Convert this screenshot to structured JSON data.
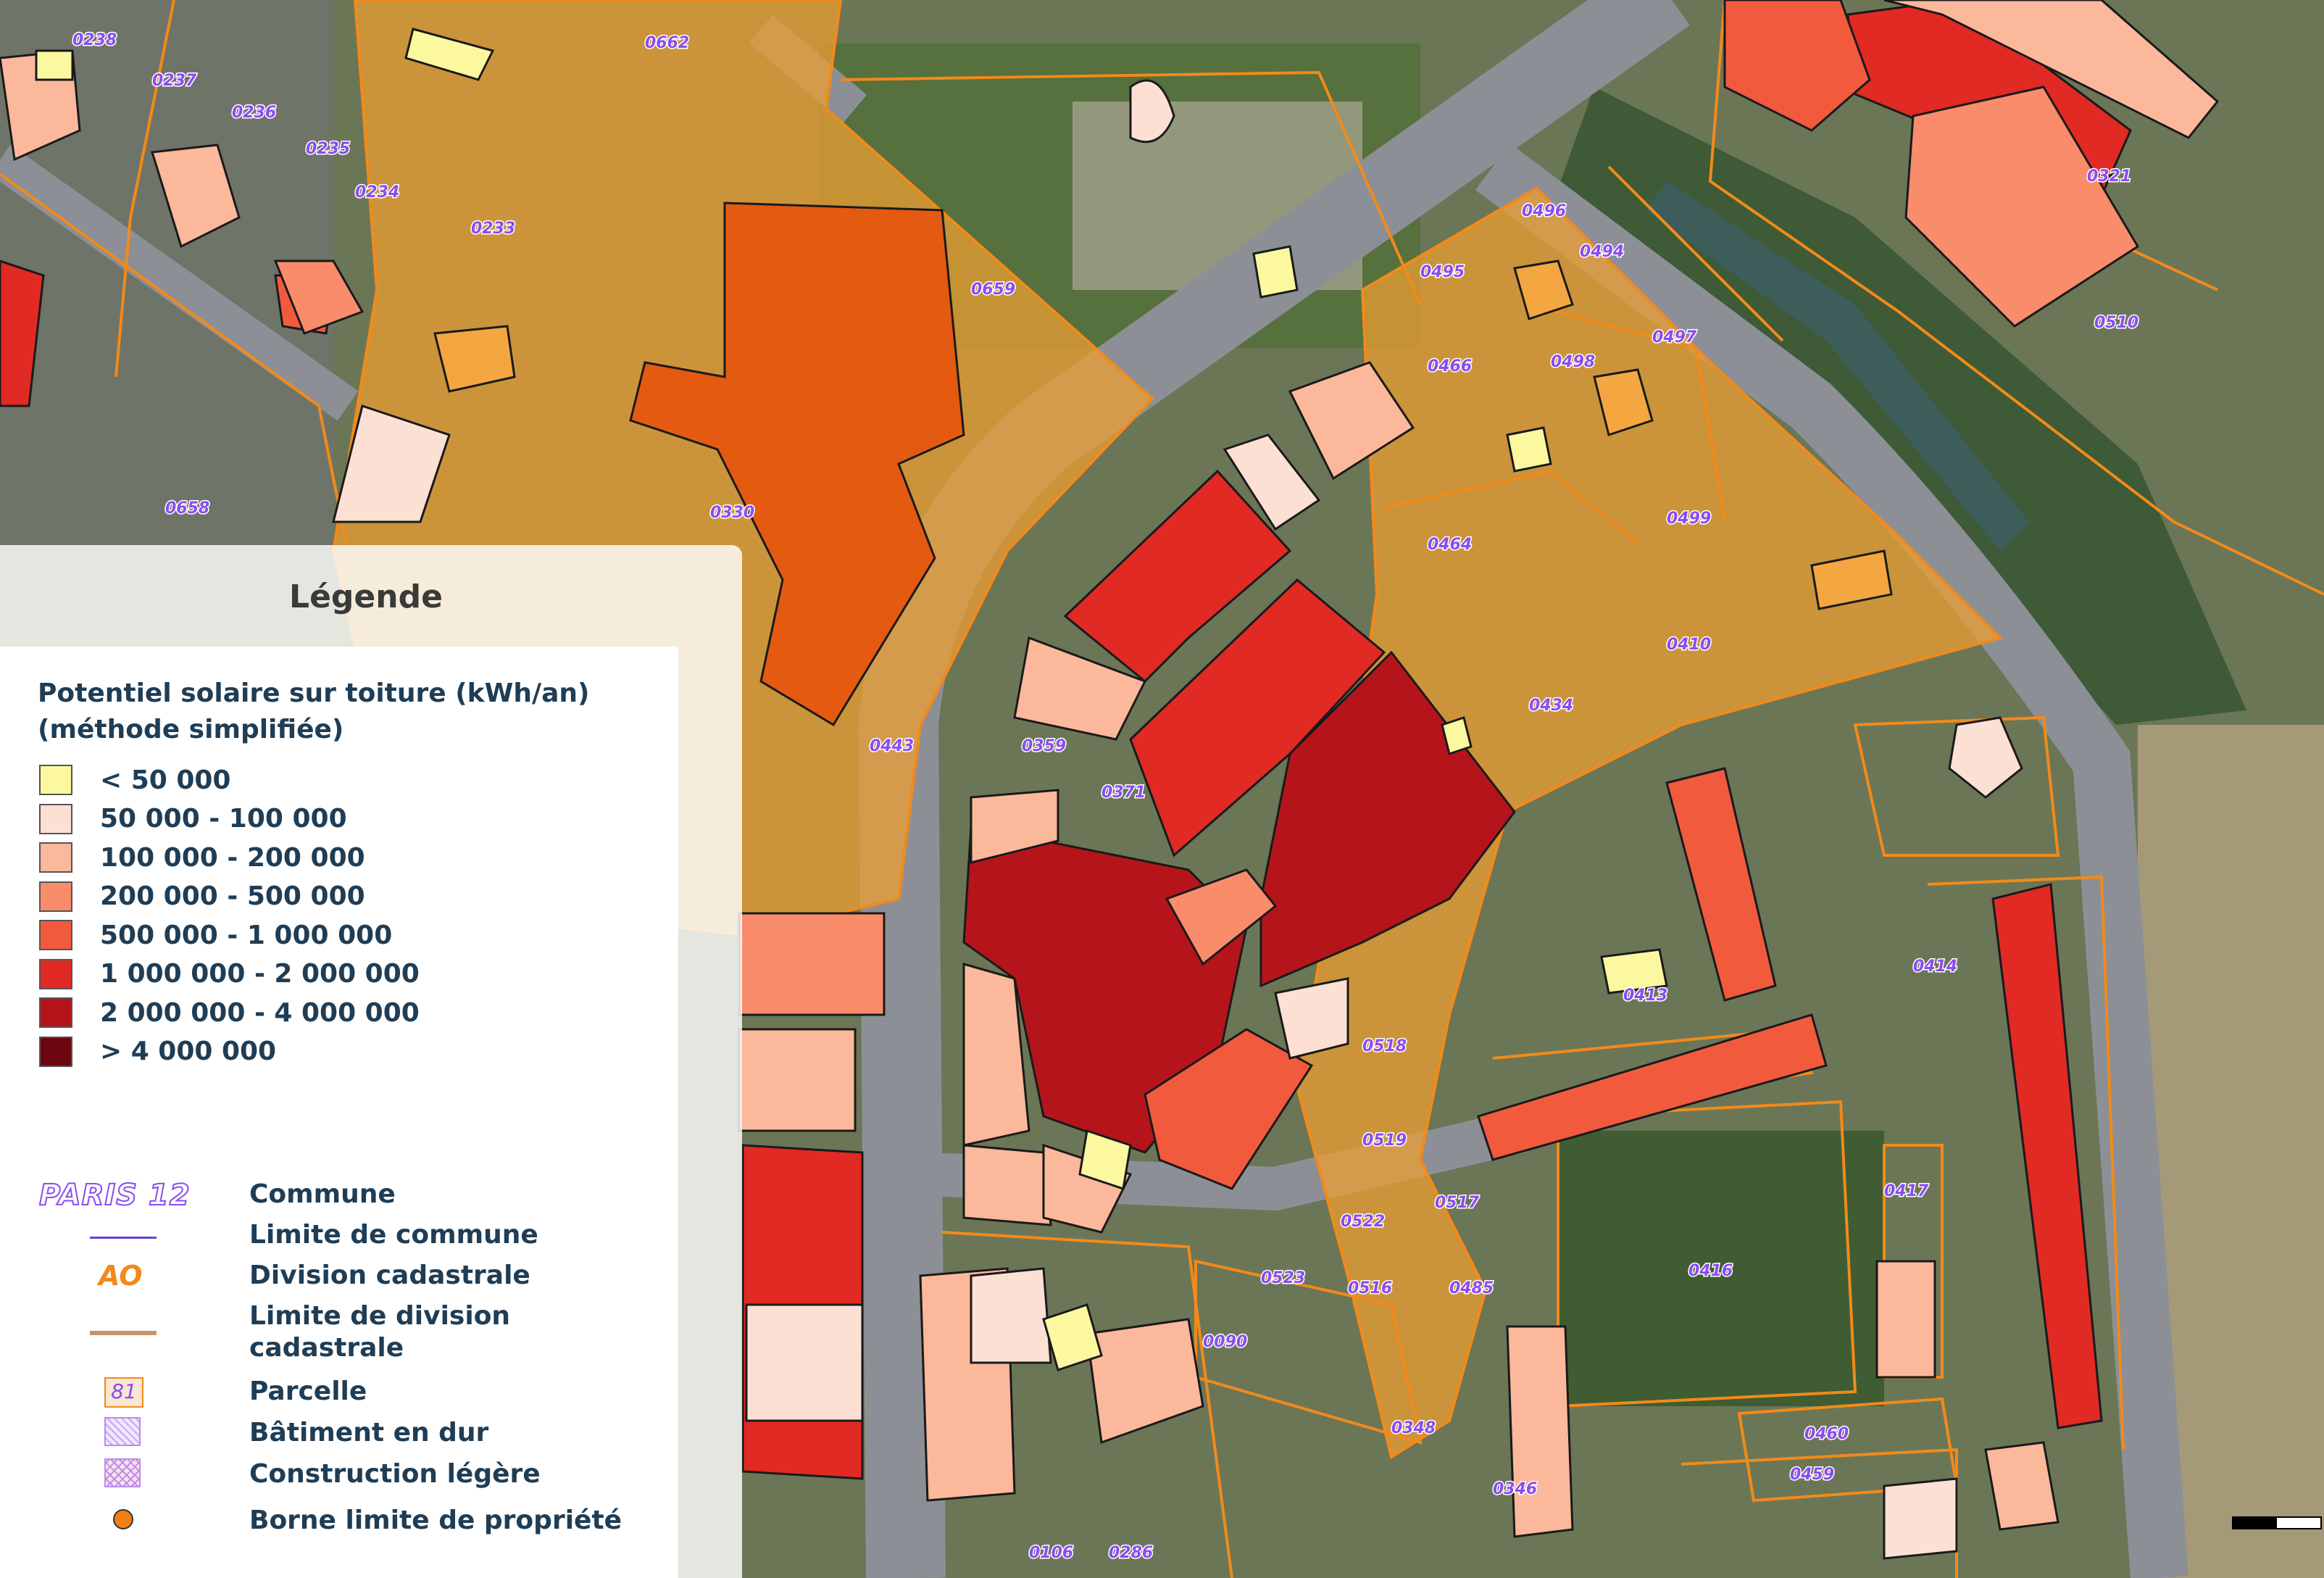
{
  "legend": {
    "title": "Légende",
    "section_title_line1": "Potentiel solaire sur toiture (kWh/an)",
    "section_title_line2": "(méthode simplifiée)",
    "classes": [
      {
        "label": "< 50 000",
        "color": "#fbf8a0"
      },
      {
        "label": "50 000 - 100 000",
        "color": "#fde0d4"
      },
      {
        "label": "100 000 - 200 000",
        "color": "#fbb89b"
      },
      {
        "label": "200 000 - 500 000",
        "color": "#f98c6b"
      },
      {
        "label": "500 000 - 1 000 000",
        "color": "#f25a3e"
      },
      {
        "label": "1 000 000 - 2 000 000",
        "color": "#e02a23"
      },
      {
        "label": "2 000 000 - 4 000 000",
        "color": "#b5141a"
      },
      {
        "label": "> 4 000 000",
        "color": "#6e0610"
      }
    ],
    "symbols": {
      "commune_sample": "PARIS 12",
      "commune_label": "Commune",
      "commune_limit_label": "Limite de commune",
      "division_sample": "AO",
      "division_label": "Division cadastrale",
      "division_limit_label_line1": "Limite de division",
      "division_limit_label_line2": "cadastrale",
      "parcel_sample": "81",
      "parcel_label": "Parcelle",
      "hard_building_label": "Bâtiment en dur",
      "light_construction_label": "Construction légère",
      "boundary_marker_label": "Borne limite de propriété"
    }
  },
  "map": {
    "colors": {
      "parcel_outline": "#f28a1a",
      "parcel_fill": "#f0a030",
      "building_outline": "#1a1a1a",
      "road": "#8a8e93",
      "vegetation": "#4f6b3a"
    },
    "parcel_labels": [
      "0238",
      "0237",
      "0236",
      "0235",
      "0234",
      "0233",
      "0662",
      "0659",
      "0658",
      "0496",
      "0494",
      "0495",
      "0497",
      "0466",
      "0498",
      "0499",
      "0464",
      "0410",
      "0434",
      "0359",
      "0371",
      "0413",
      "0414",
      "0417",
      "0416",
      "0460",
      "0459",
      "0518",
      "0519",
      "0517",
      "0522",
      "0523",
      "0516",
      "0485",
      "0090",
      "0348",
      "0346",
      "0106",
      "0286",
      "0321",
      "0510",
      "0330",
      "0443"
    ]
  }
}
